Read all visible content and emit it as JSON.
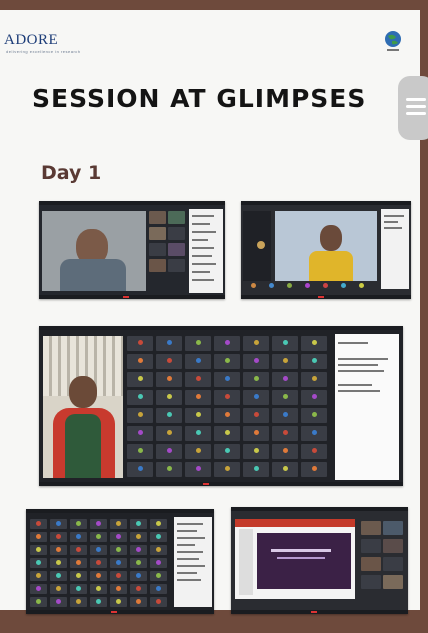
{
  "header": {
    "logo_text": "ADORE",
    "logo_tagline": "delivering excellence in research"
  },
  "title": "SESSION AT GLIMPSES",
  "day_label": "Day 1",
  "screenshots": [
    {
      "name": "screenshot-1",
      "description_icon": "video-call-icon"
    },
    {
      "name": "screenshot-2",
      "description_icon": "video-call-icon"
    },
    {
      "name": "screenshot-3",
      "description_icon": "video-call-icon"
    },
    {
      "name": "screenshot-4",
      "description_icon": "video-call-icon"
    },
    {
      "name": "screenshot-5",
      "description_icon": "video-call-icon"
    }
  ],
  "colors": {
    "frame": "#6e4a3c",
    "page": "#f7f7f5",
    "title": "#141414",
    "day": "#5a3a34",
    "logo": "#1c3c78"
  }
}
